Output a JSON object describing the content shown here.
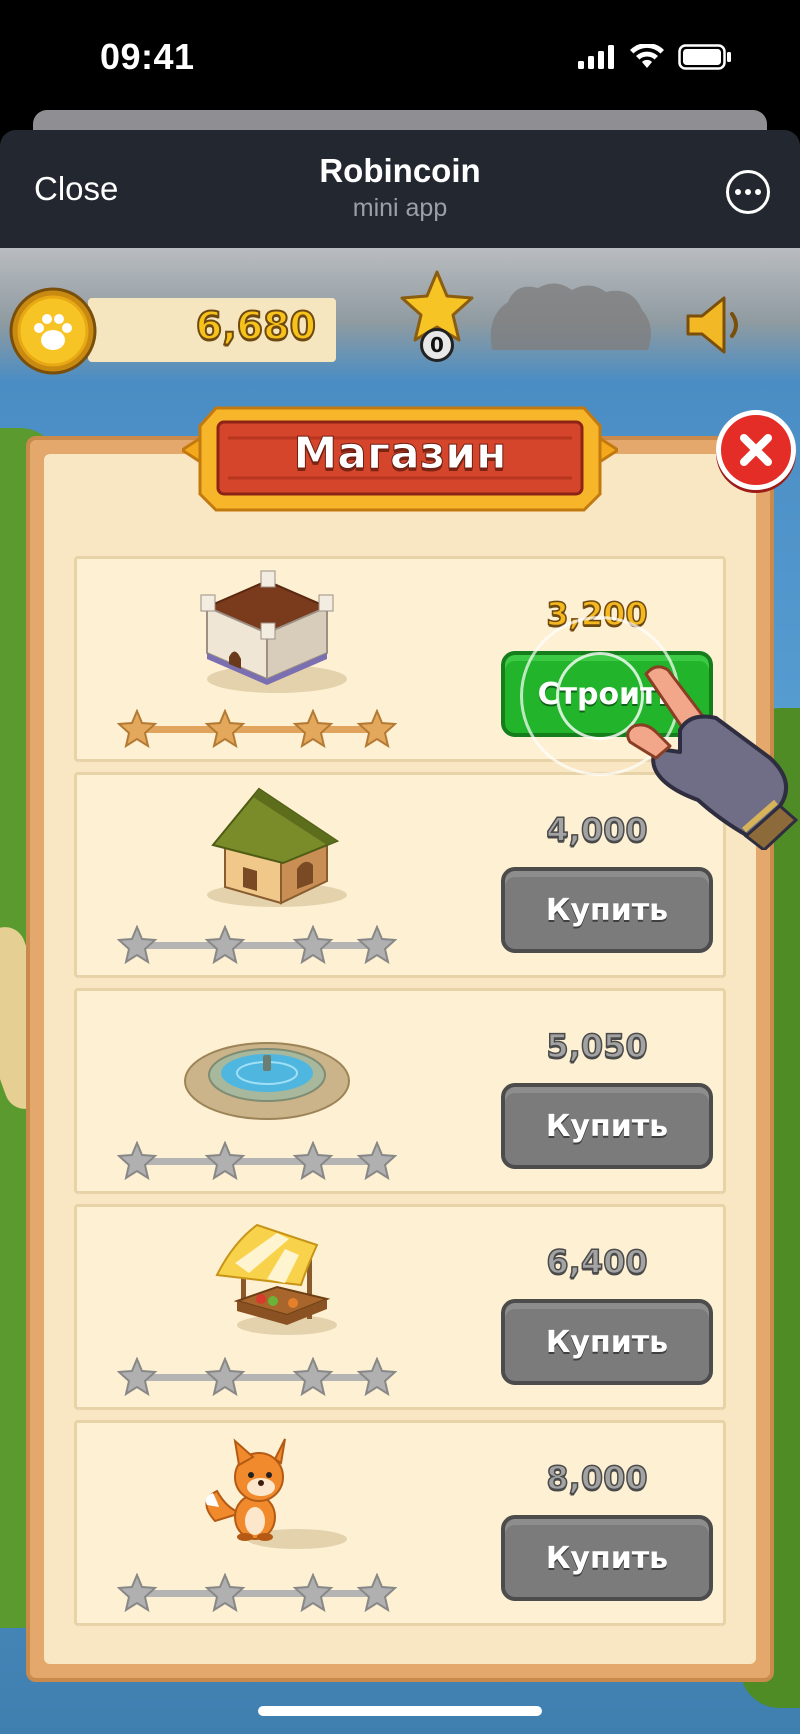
{
  "status_bar": {
    "time": "09:41"
  },
  "telegram": {
    "close_label": "Close",
    "title": "Robincoin",
    "subtitle": "mini app"
  },
  "hud": {
    "coins": "6,680",
    "stars": "0"
  },
  "shop": {
    "title": "Магазин",
    "items": [
      {
        "name": "castle",
        "price": "3,200",
        "button": "Строить",
        "stars_filled": 4,
        "stars_total": 4
      },
      {
        "name": "house",
        "price": "4,000",
        "button": "Купить",
        "stars_filled": 0,
        "stars_total": 4
      },
      {
        "name": "fountain",
        "price": "5,050",
        "button": "Купить",
        "stars_filled": 0,
        "stars_total": 4
      },
      {
        "name": "market-stall",
        "price": "6,400",
        "button": "Купить",
        "stars_filled": 0,
        "stars_total": 4
      },
      {
        "name": "fox",
        "price": "8,000",
        "button": "Купить",
        "stars_filled": 0,
        "stars_total": 4
      }
    ]
  },
  "colors": {
    "gold": "#f5b91f",
    "build_green": "#22b52b",
    "buy_grey": "#7b7b7b",
    "close_red": "#e52d27"
  }
}
